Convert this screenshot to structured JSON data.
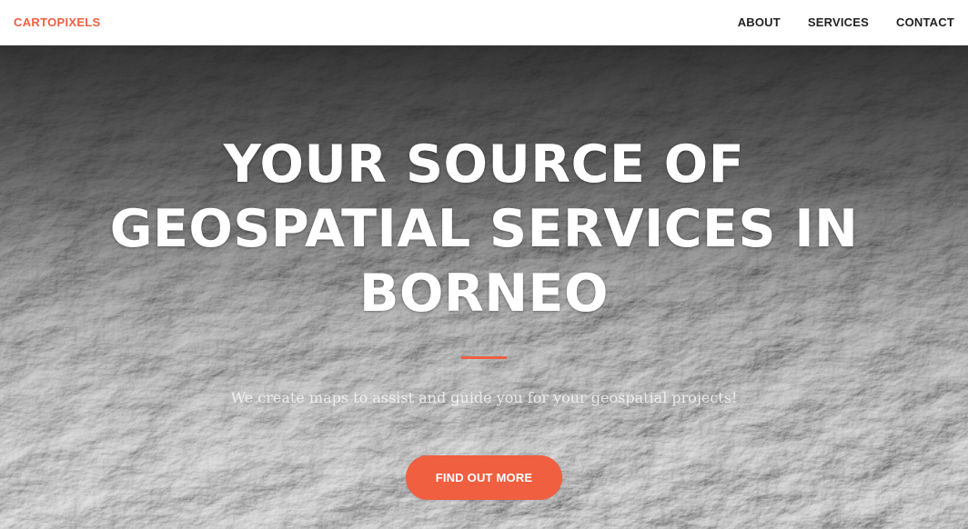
{
  "navbar": {
    "brand": "CARTOPIXELS",
    "links": [
      "ABOUT",
      "SERVICES",
      "CONTACT"
    ]
  },
  "hero": {
    "title_lines": [
      "YOUR SOURCE OF",
      "GEOSPATIAL SERVICES IN",
      "BORNEO"
    ],
    "subtitle": "We create maps to assist and guide you for your geospatial projects!",
    "cta_label": "FIND OUT MORE",
    "background": "grayscale-shaded-relief-terrain"
  },
  "colors": {
    "accent": "#f05f40",
    "nav_text": "#222222",
    "hero_text": "#ffffff"
  }
}
